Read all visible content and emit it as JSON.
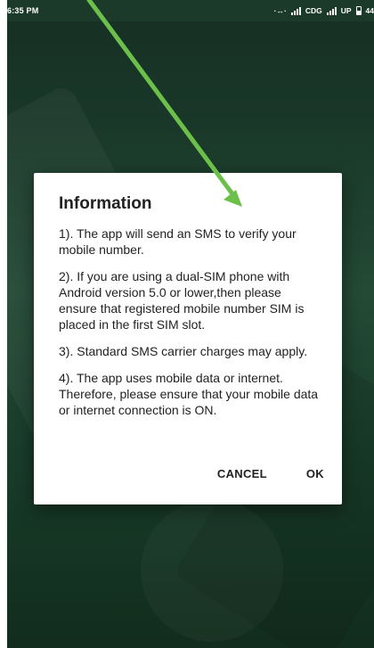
{
  "status_bar": {
    "time": "6:35 PM",
    "carrier": "CDG",
    "data_label": "UP",
    "battery_text": "44"
  },
  "dialog": {
    "title": "Information",
    "paragraphs": [
      "1). The app will send an SMS to verify your mobile number.",
      "2). If you are using a dual-SIM phone with Android version 5.0 or lower,then please ensure that registered mobile number SIM is placed in the first SIM slot.",
      "3). Standard SMS carrier charges may apply.",
      "4). The app uses mobile data or internet. Therefore, please ensure that your mobile data or internet connection is ON."
    ],
    "cancel_label": "CANCEL",
    "ok_label": "OK"
  },
  "annotation": {
    "arrow_color": "#6cc04a"
  },
  "colors": {
    "background_dark": "#1c3b2c",
    "background_mid": "#2c5a40",
    "dialog_bg": "#ffffff",
    "text": "#212121"
  }
}
